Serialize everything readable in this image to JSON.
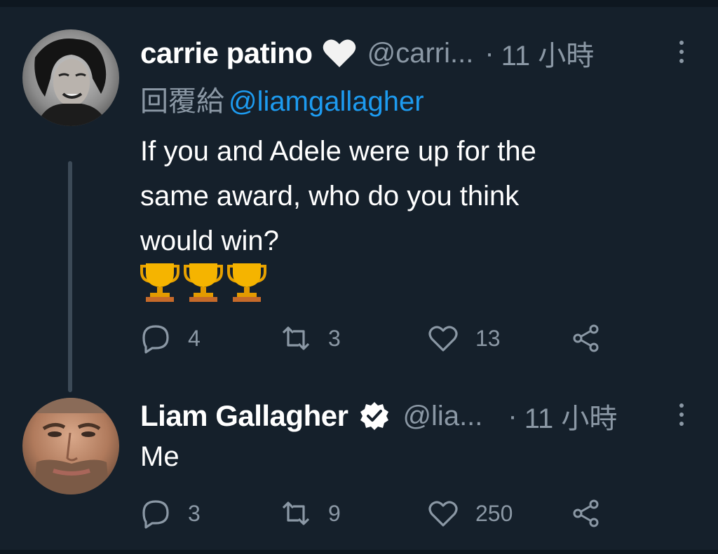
{
  "tweets": [
    {
      "display_name": "carrie patino",
      "badge_icon": "heart-icon",
      "handle": "@carri...",
      "separator": "·",
      "time": "11 小時",
      "reply_prefix": "回覆給",
      "reply_mention": "@liamgallagher",
      "text_lines": [
        "If you and Adele were up for the",
        "same award, who do you think",
        "would win?"
      ],
      "emoji": [
        "trophy-icon",
        "trophy-icon",
        "trophy-icon"
      ],
      "actions": {
        "replies": "4",
        "retweets": "3",
        "likes": "13"
      }
    },
    {
      "display_name": "Liam Gallagher",
      "badge_icon": "verified-icon",
      "handle": "@lia...",
      "separator": "·",
      "time": "11 小時",
      "text_lines": [
        "Me"
      ],
      "actions": {
        "replies": "3",
        "retweets": "9",
        "likes": "250"
      }
    }
  ],
  "colors": {
    "background": "#15202b",
    "text_primary": "#ffffff",
    "text_secondary": "#8b98a5",
    "link": "#1d9bf0",
    "thread_line": "#3c4a57"
  }
}
